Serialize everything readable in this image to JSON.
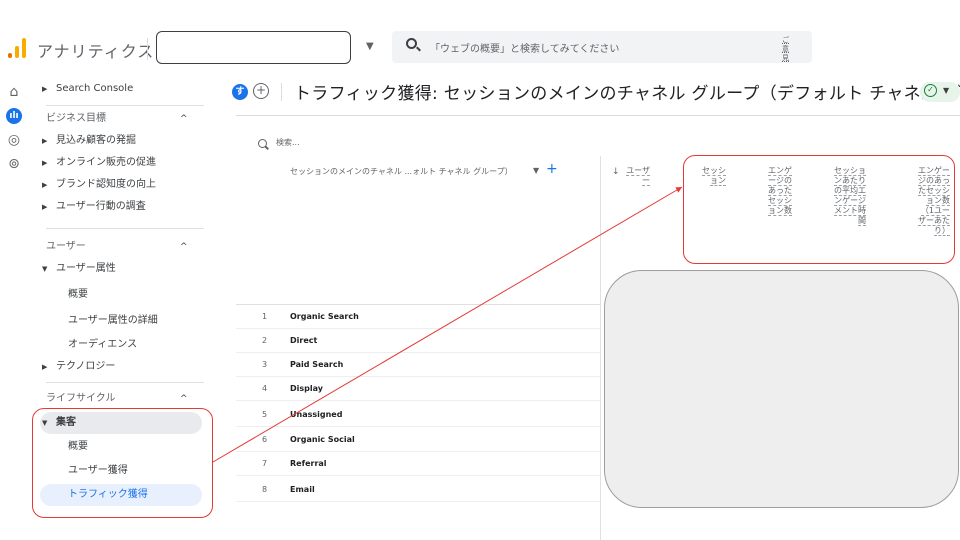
{
  "header": {
    "app_title": "アナリティクス",
    "search_placeholder": "「ウェブの概要」と検索してみてください",
    "search_side": "ご意見"
  },
  "rail": {
    "icons": [
      "home-icon",
      "reports-icon",
      "explore-icon",
      "advertising-icon"
    ],
    "active_label": "ılı"
  },
  "sidebar": {
    "search_console": "Search Console",
    "business_goals": "ビジネス目標",
    "goal_items": [
      "見込み顧客の発掘",
      "オンライン販売の促進",
      "ブランド認知度の向上",
      "ユーザー行動の調査"
    ],
    "user_section": "ユーザー",
    "user_attr": "ユーザー属性",
    "user_attr_items": [
      "概要",
      "ユーザー属性の詳細",
      "オーディエンス"
    ],
    "technology": "テクノロジー",
    "lifecycle": "ライフサイクル",
    "acquisition": "集客",
    "acquisition_items": [
      "概要",
      "ユーザー獲得",
      "トラフィック獲得"
    ]
  },
  "report": {
    "badge": "す",
    "title": "トラフィック獲得: セッションのメインのチャネル グループ（デフォルト チャネル グループ）"
  },
  "table": {
    "search_placeholder": "検索...",
    "dimension_header": "セッションのメインのチャネル ...ォルト チャネル グループ）",
    "metrics": [
      [
        "ユーザ",
        "ー"
      ],
      [
        "セッシ",
        "ョン"
      ],
      [
        "エンゲ",
        "ージの",
        "あった",
        "セッシ",
        "ョン数"
      ],
      [
        "セッショ",
        "ンあたり",
        "の平均エ",
        "ンゲージ",
        "メント時",
        "間"
      ],
      [
        "エンゲー",
        "ジのあっ",
        "たセッシ",
        "ョン数",
        "（1ユー",
        "ザーあた",
        "り）"
      ]
    ],
    "rows": [
      {
        "num": "1",
        "name": "Organic Search"
      },
      {
        "num": "2",
        "name": "Direct"
      },
      {
        "num": "3",
        "name": "Paid Search"
      },
      {
        "num": "4",
        "name": "Display"
      },
      {
        "num": "5",
        "name": "Unassigned"
      },
      {
        "num": "6",
        "name": "Organic Social"
      },
      {
        "num": "7",
        "name": "Referral"
      },
      {
        "num": "8",
        "name": "Email"
      }
    ]
  },
  "colors": {
    "accent": "#1a73e8",
    "annotation": "#e53935",
    "logo_orange": "#f9ab00"
  }
}
